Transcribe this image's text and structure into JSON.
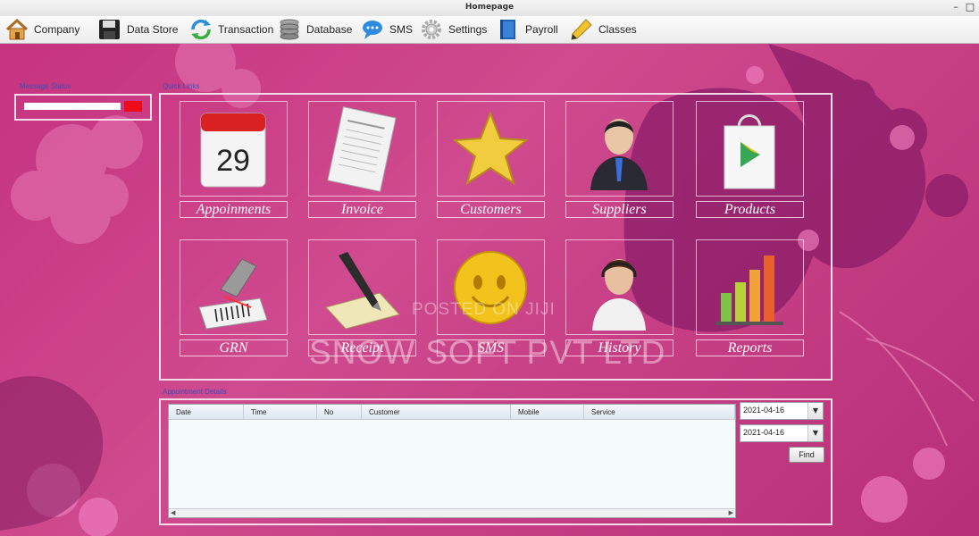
{
  "window": {
    "title": "Homepage",
    "minimize": "–",
    "maximize": "□"
  },
  "menu": [
    {
      "label": "Company",
      "icon": "house-icon"
    },
    {
      "label": "Data Store",
      "icon": "floppy-disk-icon"
    },
    {
      "label": "Transaction",
      "icon": "refresh-arrows-icon"
    },
    {
      "label": "Database",
      "icon": "database-icon"
    },
    {
      "label": "SMS",
      "icon": "speech-bubble-icon"
    },
    {
      "label": "Settings",
      "icon": "gear-icon"
    },
    {
      "label": "Payroll",
      "icon": "book-icon"
    },
    {
      "label": "Classes",
      "icon": "pencil-icon"
    }
  ],
  "message_status": {
    "label": "Message Status",
    "led_color": "#ee0b1a"
  },
  "quick_links": {
    "label": "Quick Links",
    "tiles": [
      {
        "label": "Appoinments",
        "icon": "calendar-icon"
      },
      {
        "label": "Invoice",
        "icon": "invoice-icon"
      },
      {
        "label": "Customers",
        "icon": "star-icon"
      },
      {
        "label": "Suppliers",
        "icon": "businessman-icon"
      },
      {
        "label": "Products",
        "icon": "shopping-bag-icon"
      },
      {
        "label": "GRN",
        "icon": "barcode-scanner-icon"
      },
      {
        "label": "Receipt",
        "icon": "pen-paper-icon"
      },
      {
        "label": "SMS",
        "icon": "smiley-icon"
      },
      {
        "label": "History",
        "icon": "headset-person-icon"
      },
      {
        "label": "Reports",
        "icon": "bar-chart-icon"
      }
    ]
  },
  "appointments": {
    "label": "Appointment Details",
    "columns": [
      "Date",
      "Time",
      "No",
      "Customer",
      "Mobile",
      "Service"
    ],
    "rows": [],
    "date_from": "2021-04-16",
    "date_to": "2021-04-16",
    "find_label": "Find"
  },
  "watermark": {
    "line1": "POSTED ON JIJI",
    "line2": "SNOW SOFT PVT LTD"
  },
  "colors": {
    "background": "#c2357c",
    "panel_border": "#f3dbe8",
    "group_label": "#3a4fb5"
  }
}
